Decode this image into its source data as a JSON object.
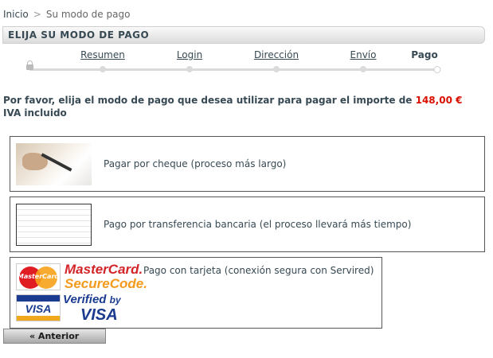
{
  "breadcrumb": {
    "home": "Inicio",
    "separator": ">",
    "current": "Su modo de pago"
  },
  "title": "ELIJA SU MODO DE PAGO",
  "steps": [
    "Resumen",
    "Login",
    "Dirección",
    "Envío",
    "Pago"
  ],
  "intro": {
    "text": "Por favor, elija el modo de pago que desea utilizar para pagar el importe de",
    "amount": "148,00 €",
    "suffix": "IVA incluido"
  },
  "options": [
    {
      "label": "Pagar por cheque (proceso más largo)"
    },
    {
      "label": "Pago por transferencia bancaria (el proceso llevará más tiempo)"
    },
    {
      "label": "Pago con tarjeta (conexión segura con Servired)"
    }
  ],
  "logos": {
    "mastercard": "MasterCard",
    "securecode_a": "MasterCard.",
    "securecode_b": "SecureCode.",
    "visa": "VISA",
    "verified_a": "Verified",
    "verified_by": "by",
    "verified_visa": "VISA"
  },
  "buttons": {
    "previous": "« Anterior"
  },
  "colors": {
    "text": "#374953",
    "amount": "#da0f00",
    "track": "#dadada"
  }
}
